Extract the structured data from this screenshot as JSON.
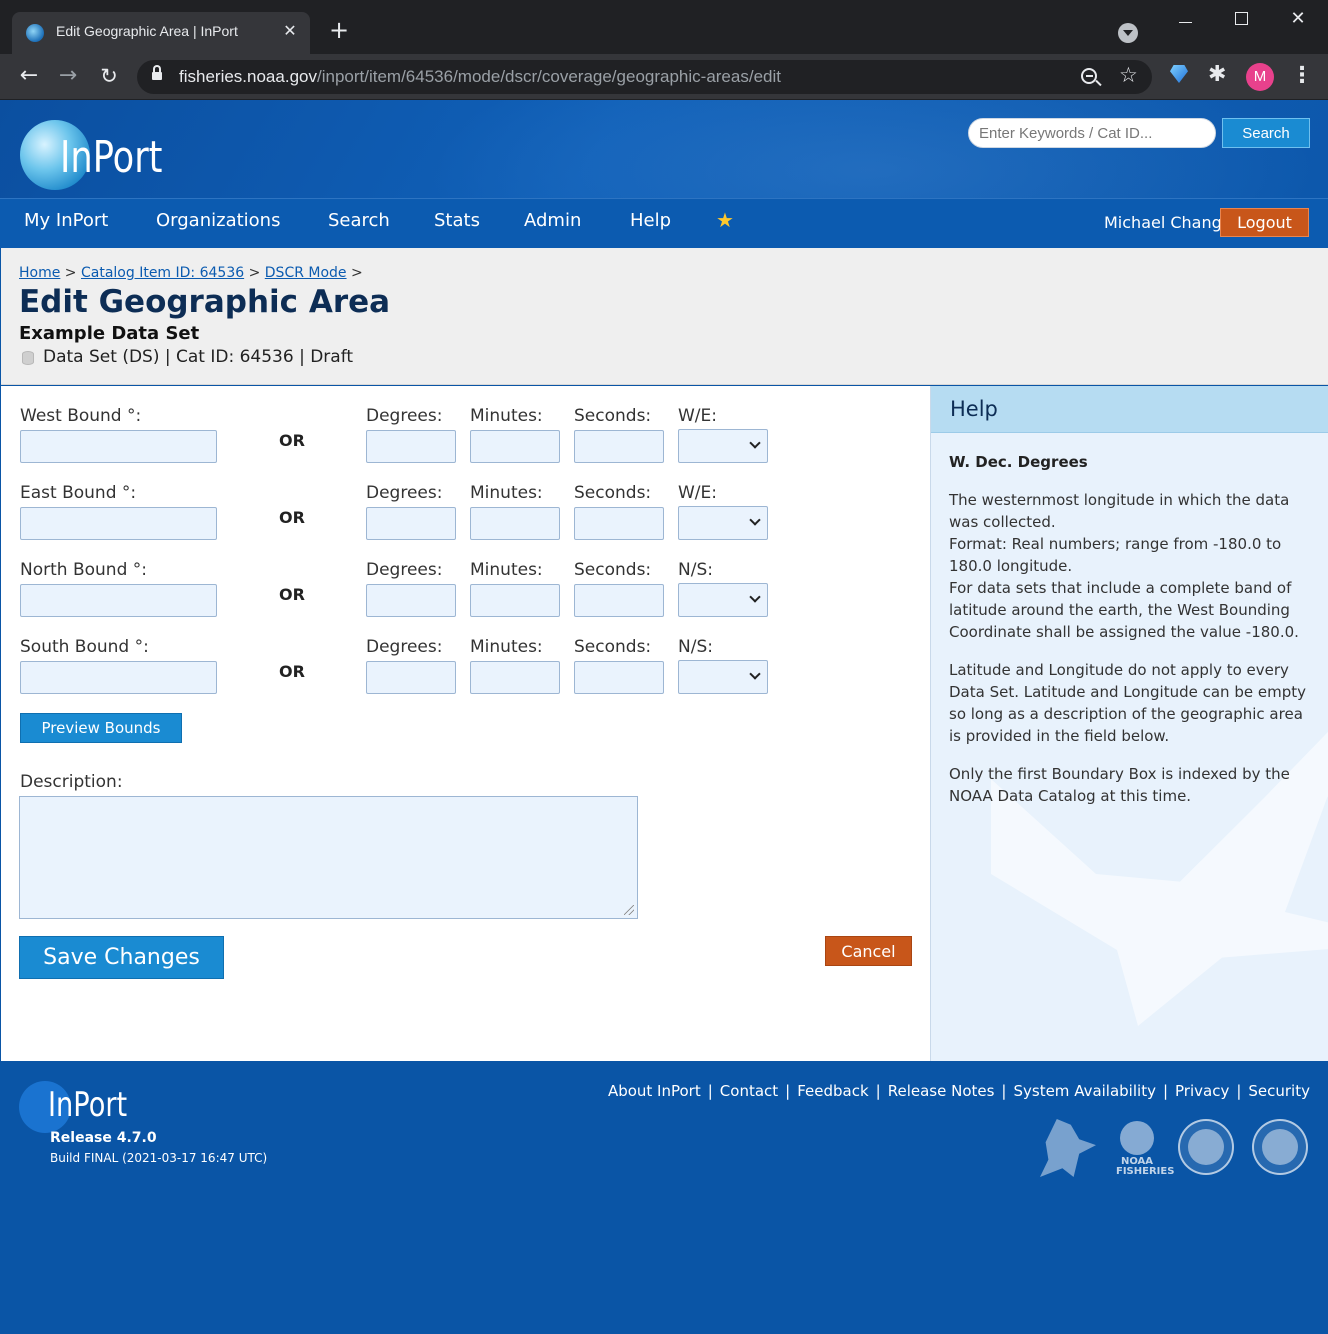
{
  "browser": {
    "tab_title": "Edit Geographic Area | InPort",
    "tab_close": "✕",
    "new_tab": "+",
    "url_host": "fisheries.noaa.gov",
    "url_path": "/inport/item/64536/mode/dscr/coverage/geographic-areas/edit",
    "avatar_letter": "M"
  },
  "header": {
    "logo_text": "InPort",
    "search_placeholder": "Enter Keywords / Cat ID...",
    "search_button": "Search"
  },
  "nav": {
    "items": [
      "My InPort",
      "Organizations",
      "Search",
      "Stats",
      "Admin",
      "Help"
    ],
    "user_name": "Michael Chang",
    "logout": "Logout"
  },
  "title_band": {
    "breadcrumb": [
      "Home",
      "Catalog Item ID: 64536",
      "DSCR Mode"
    ],
    "breadcrumb_sep": ">",
    "page_title": "Edit Geographic Area",
    "dataset_name": "Example Data Set",
    "dataset_meta": "Data Set (DS) | Cat ID: 64536 | Draft"
  },
  "form": {
    "or_label": "OR",
    "degrees_label": "Degrees:",
    "minutes_label": "Minutes:",
    "seconds_label": "Seconds:",
    "rows": [
      {
        "label": "West Bound °:",
        "dir_label": "W/E:"
      },
      {
        "label": "East Bound °:",
        "dir_label": "W/E:"
      },
      {
        "label": "North Bound °:",
        "dir_label": "N/S:"
      },
      {
        "label": "South Bound °:",
        "dir_label": "N/S:"
      }
    ],
    "preview_button": "Preview Bounds",
    "description_label": "Description:",
    "save_button": "Save Changes",
    "cancel_button": "Cancel"
  },
  "help": {
    "title": "Help",
    "topic": "W. Dec. Degrees",
    "para1": "The westernmost longitude in which the data was collected.",
    "para2": "Format: Real numbers; range from -180.0 to 180.0 longitude.",
    "para3": "For data sets that include a complete band of latitude around the earth, the West Bounding Coordinate shall be assigned the value -180.0.",
    "para4": "Latitude and Longitude do not apply to every Data Set. Latitude and Longitude can be empty so long as a description of the geographic area is provided in the field below.",
    "para5": "Only the first Boundary Box is indexed by the NOAA Data Catalog at this time."
  },
  "footer": {
    "logo_text": "InPort",
    "release": "Release 4.7.0",
    "build": "Build FINAL (2021-03-17 16:47 UTC)",
    "links": [
      "About InPort",
      "Contact",
      "Feedback",
      "Release Notes",
      "System Availability",
      "Privacy",
      "Security"
    ],
    "link_sep": "|",
    "noaa_fisheries_text": "NOAA FISHERIES"
  }
}
